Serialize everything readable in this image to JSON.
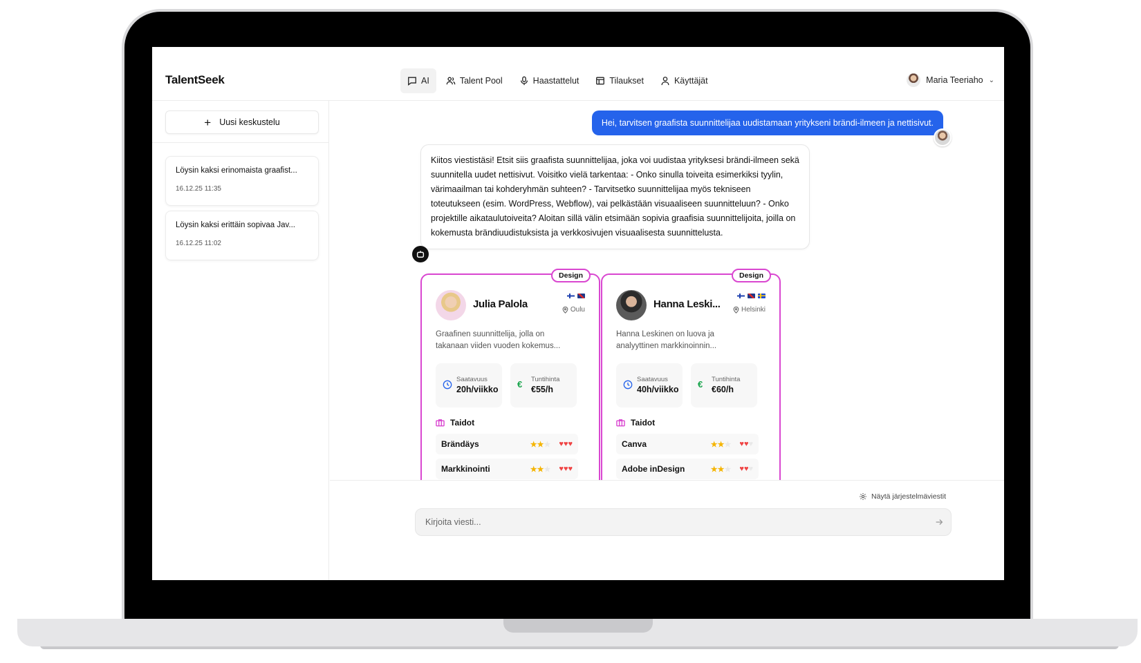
{
  "app": {
    "brand": "TalentSeek"
  },
  "nav": {
    "items": [
      {
        "label": "AI",
        "icon": "chat-icon",
        "active": true
      },
      {
        "label": "Talent Pool",
        "icon": "users-icon"
      },
      {
        "label": "Haastattelut",
        "icon": "microphone-icon"
      },
      {
        "label": "Tilaukset",
        "icon": "table-icon"
      },
      {
        "label": "Käyttäjät",
        "icon": "user-icon"
      }
    ]
  },
  "user": {
    "name": "Maria Teeriaho"
  },
  "sidebar": {
    "new_chat_label": "Uusi keskustelu",
    "conversations": [
      {
        "title": "Löysin kaksi erinomaista graafist...",
        "date": "16.12.25 11:35"
      },
      {
        "title": "Löysin kaksi erittäin sopivaa Jav...",
        "date": "16.12.25 11:02"
      }
    ]
  },
  "chat": {
    "user_message": "Hei, tarvitsen graafista suunnittelijaa uudistamaan yritykseni brändi-ilmeen ja nettisivut.",
    "ai_message": "Kiitos viestistäsi! Etsit siis graafista suunnittelijaa, joka voi uudistaa yrityksesi brändi-ilmeen sekä suunnitella uudet nettisivut. Voisitko vielä tarkentaa: - Onko sinulla toiveita esimerkiksi tyylin, värimaailman tai kohderyhmän suhteen? - Tarvitsetko suunnittelijaa myös tekniseen toteutukseen (esim. WordPress, Webflow), vai pelkästään visuaaliseen suunnitteluun? - Onko projektille aikataulutoiveita? Aloitan sillä välin etsimään sopivia graafisia suunnittelijoita, joilla on kokemusta brändiuudistuksista ja verkkosivujen visuaalisesta suunnittelusta."
  },
  "cards": [
    {
      "badge": "Design",
      "name": "Julia Palola",
      "city": "Oulu",
      "languages": [
        "fi",
        "gb"
      ],
      "description_line1": "Graafinen suunnittelija, jolla on",
      "description_line2": "takanaan viiden vuoden kokemus...",
      "availability_label": "Saatavuus",
      "availability_value": "20h/viikko",
      "rate_label": "Tuntihinta",
      "rate_value": "€55/h",
      "skills_label": "Taidot",
      "skills": [
        {
          "name": "Brändäys",
          "stars": 2,
          "hearts": 3
        },
        {
          "name": "Markkinointi",
          "stars": 2,
          "hearts": 3
        }
      ]
    },
    {
      "badge": "Design",
      "name": "Hanna Leski...",
      "city": "Helsinki",
      "languages": [
        "fi",
        "gb",
        "se"
      ],
      "description_line1": "Hanna Leskinen on luova ja",
      "description_line2": "analyyttinen markkinoinnin...",
      "availability_label": "Saatavuus",
      "availability_value": "40h/viikko",
      "rate_label": "Tuntihinta",
      "rate_value": "€60/h",
      "skills_label": "Taidot",
      "skills": [
        {
          "name": "Canva",
          "stars": 2,
          "hearts": 2
        },
        {
          "name": "Adobe inDesign",
          "stars": 2,
          "hearts": 2
        }
      ]
    }
  ],
  "composer": {
    "system_toggle_label": "Näytä järjestelmäviestit",
    "placeholder": "Kirjoita viesti..."
  },
  "colors": {
    "accent_blue": "#2563eb",
    "card_border": "#d946d0",
    "star": "#f5b400",
    "heart": "#ef4444"
  }
}
